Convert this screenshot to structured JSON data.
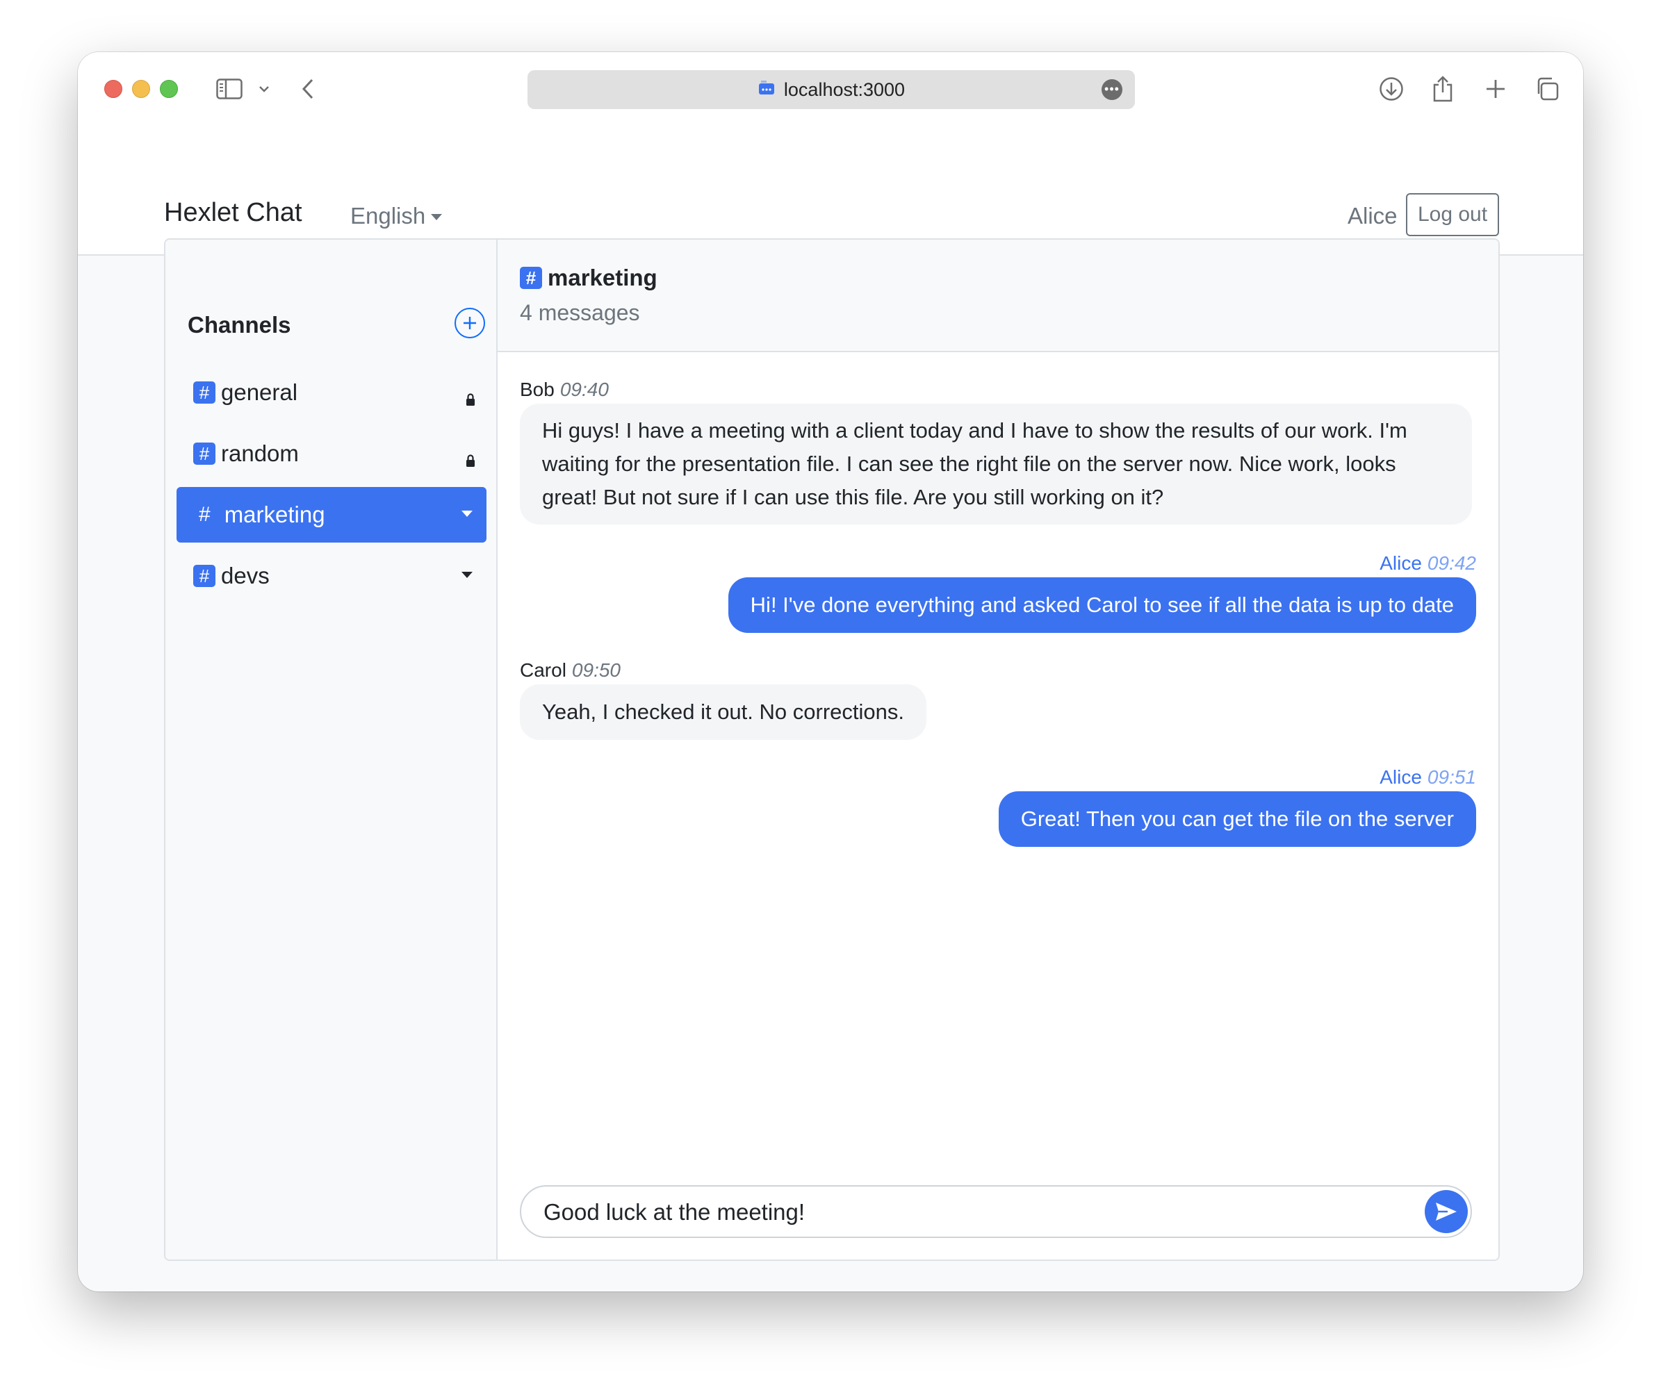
{
  "browser": {
    "url": "localhost:3000"
  },
  "navbar": {
    "brand": "Hexlet Chat",
    "language": "English",
    "username": "Alice",
    "logout_label": "Log out"
  },
  "sidebar": {
    "title": "Channels",
    "channels": [
      {
        "name": "general",
        "locked": true,
        "active": false
      },
      {
        "name": "random",
        "locked": true,
        "active": false
      },
      {
        "name": "marketing",
        "locked": false,
        "active": true
      },
      {
        "name": "devs",
        "locked": false,
        "active": false
      }
    ]
  },
  "chat": {
    "channel_name": "marketing",
    "message_count": "4 messages",
    "hash": "#",
    "messages": [
      {
        "author": "Bob",
        "time": "09:40",
        "text": "Hi guys! I have a meeting with a client today and I have to show the results of our work. I'm waiting for the presentation file. I can see the right file on the server now. Nice work, looks great! But not sure if I can use this file. Are you still working on it?",
        "mine": false
      },
      {
        "author": "Alice",
        "time": "09:42",
        "text": "Hi! I've done everything and asked Carol to see if all the data is up to date",
        "mine": true
      },
      {
        "author": "Carol",
        "time": "09:50",
        "text": "Yeah, I checked it out. No corrections.",
        "mine": false
      },
      {
        "author": "Alice",
        "time": "09:51",
        "text": "Great! Then you can get the file on the server",
        "mine": true
      }
    ],
    "composer_value": "Good luck at the meeting!"
  },
  "colors": {
    "accent": "#3b72f0",
    "muted": "#6c757d",
    "sidebar_bg": "#f8f9fa",
    "bubble_other": "#f4f5f6"
  },
  "icons": [
    "sidebar-toggle-icon",
    "chevron-down-icon",
    "back-icon",
    "site-icon",
    "more-icon",
    "download-icon",
    "share-icon",
    "new-tab-icon",
    "tabs-overview-icon",
    "plus-circle-icon",
    "lock-icon",
    "send-icon"
  ]
}
